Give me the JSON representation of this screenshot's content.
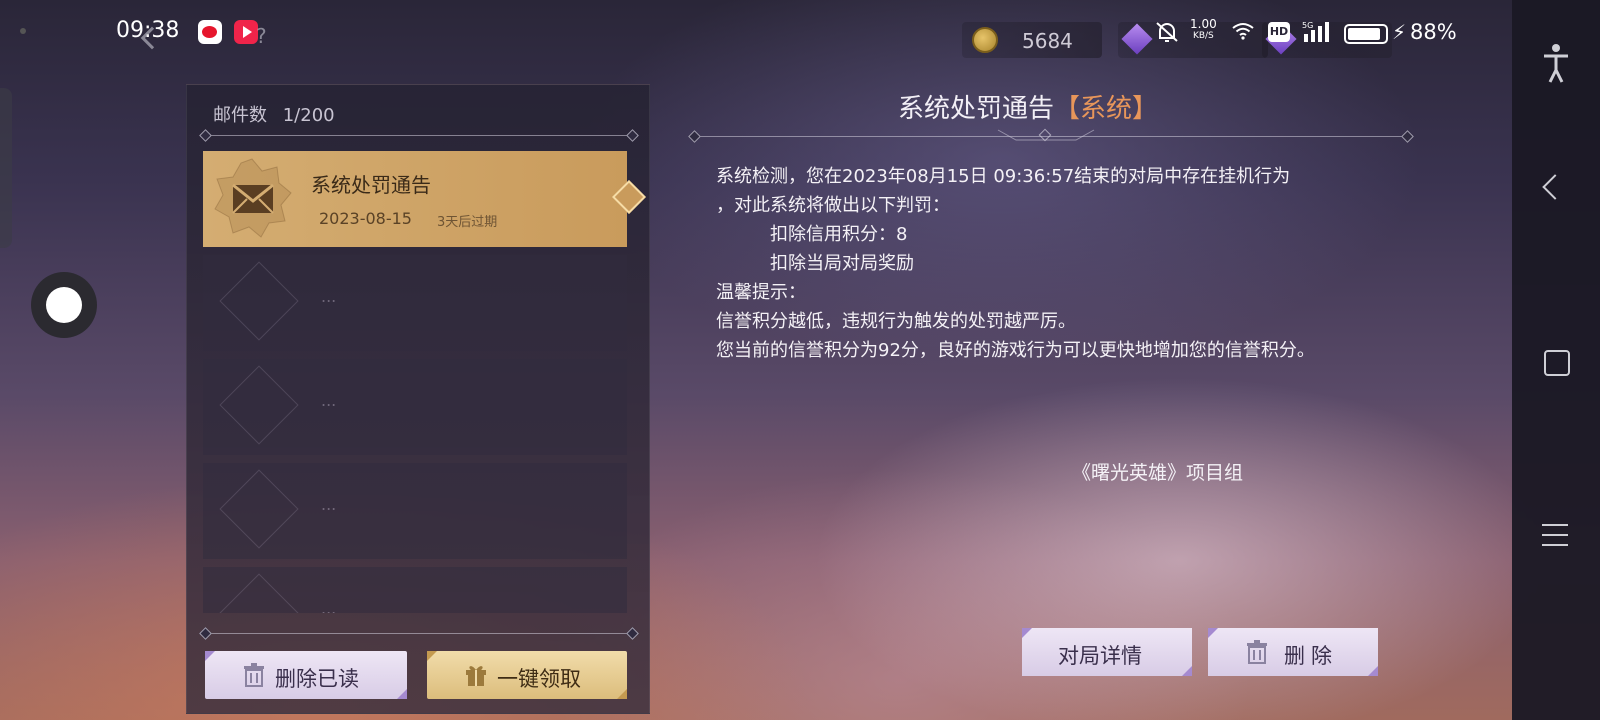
{
  "status_bar": {
    "time": "09:38",
    "speed_value": "1.00",
    "speed_unit": "KB/S",
    "battery_percent": "88%",
    "hd_label": "HD"
  },
  "currencies": {
    "gold": "5684"
  },
  "mail_list": {
    "count_label": "邮件数",
    "count_value": "1/200",
    "items": [
      {
        "title": "系统处罚通告",
        "date": "2023-08-15",
        "expiry": "3天后过期"
      }
    ],
    "empty_placeholder": "..."
  },
  "buttons": {
    "delete_read": "删除已读",
    "claim_all": "一键领取",
    "battle_details": "对局详情",
    "delete": "删除"
  },
  "detail": {
    "title": "系统处罚通告",
    "tag": "【系统】",
    "lines": [
      "系统检测，您在2023年08月15日 09:36:57结束的对局中存在挂机行为",
      "，对此系统将做出以下判罚：",
      "扣除信用积分：8",
      "扣除当局对局奖励",
      "温馨提示：",
      "信誉积分越低，违规行为触发的处罚越严厉。",
      "您当前的信誉积分为92分，良好的游戏行为可以更快地增加您的信誉积分。"
    ],
    "signature": "《曙光英雄》项目组"
  }
}
